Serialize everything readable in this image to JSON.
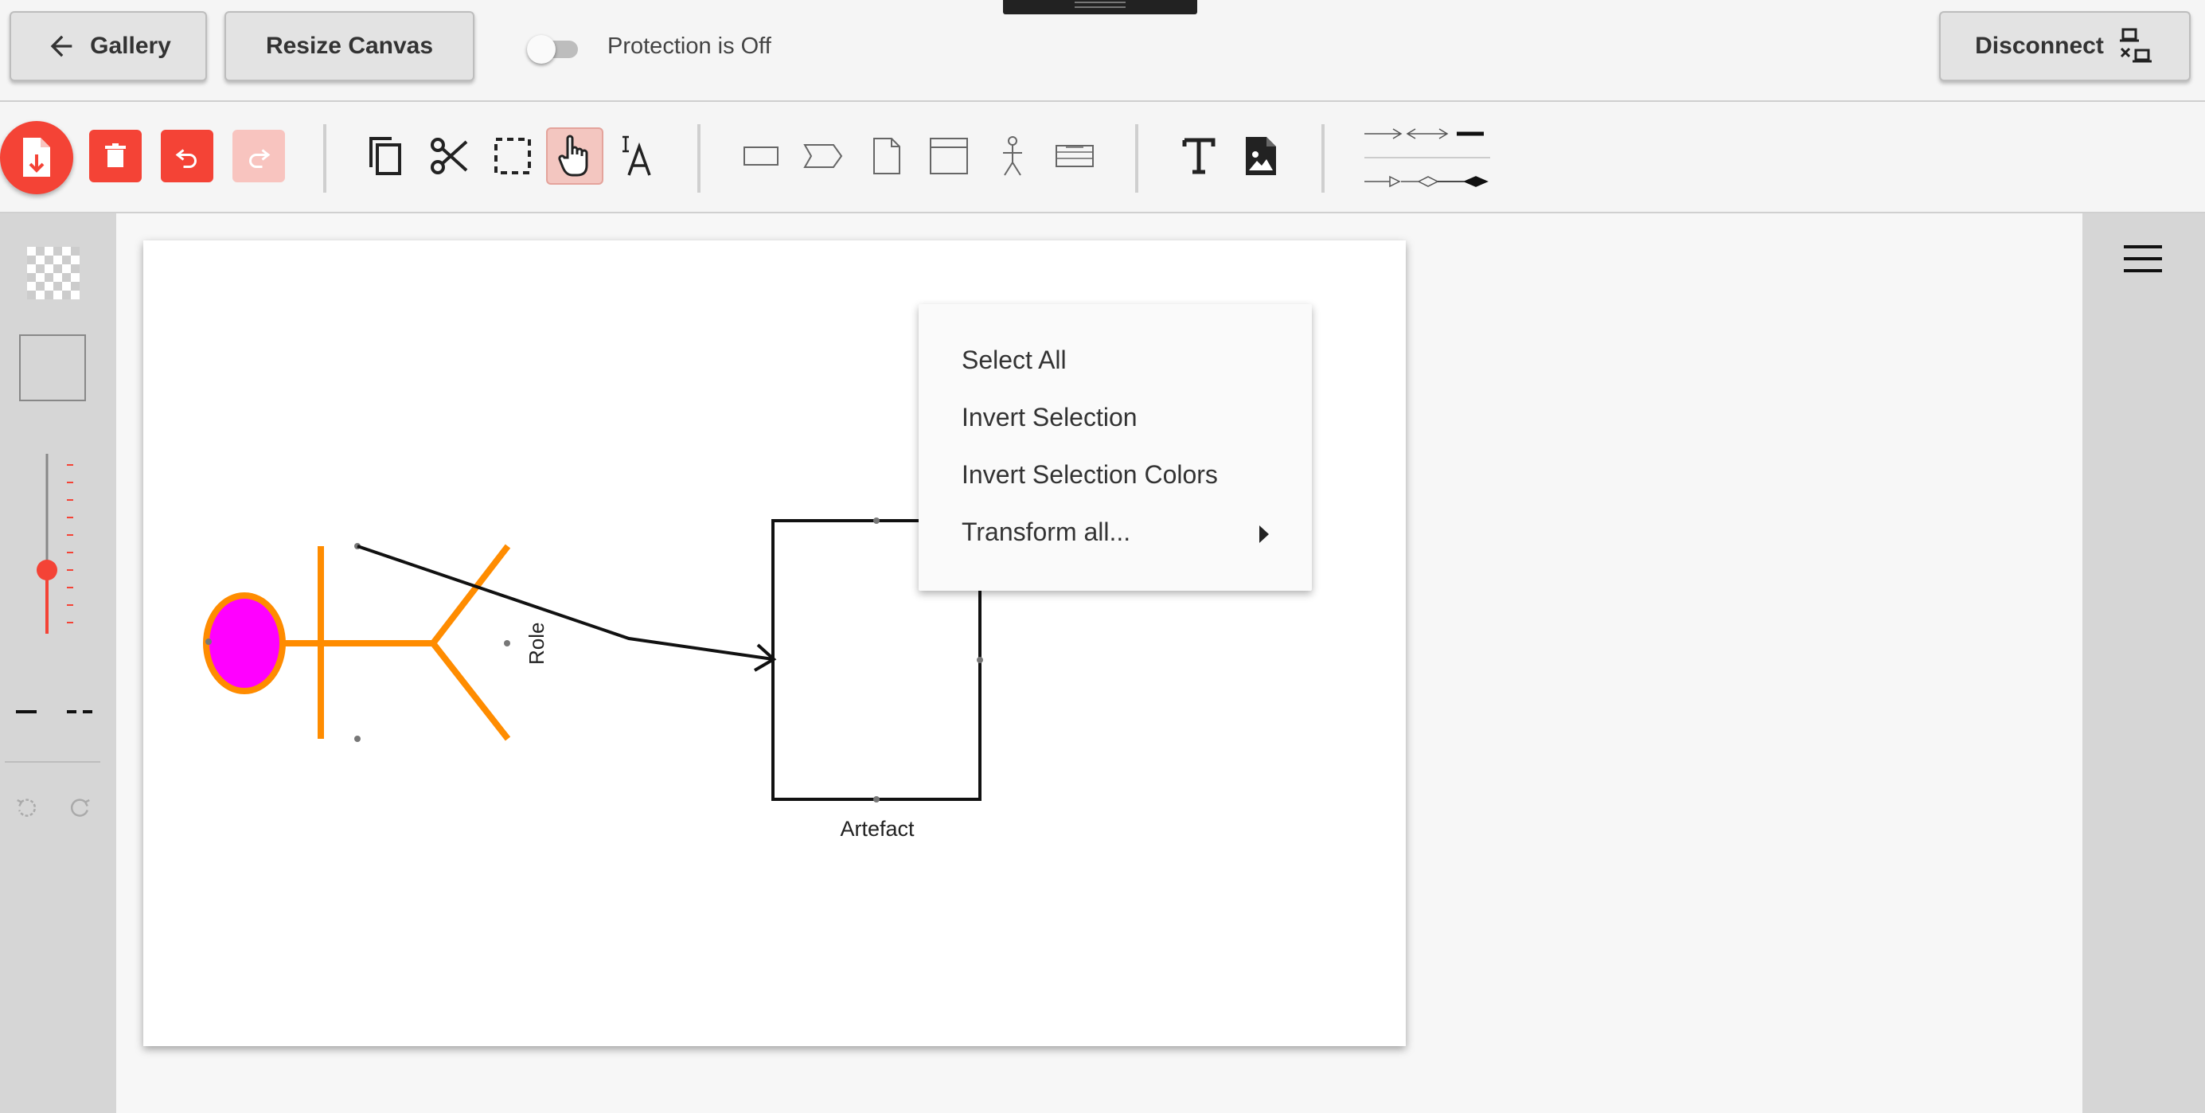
{
  "topbar": {
    "gallery_label": "Gallery",
    "resize_label": "Resize Canvas",
    "protection_label": "Protection is Off",
    "protection_on": false,
    "disconnect_label": "Disconnect"
  },
  "toolbar": {
    "file_tools": [
      "new-file-icon",
      "delete-icon",
      "undo-icon",
      "redo-icon"
    ],
    "edit_tools": [
      "copy-icon",
      "cut-icon",
      "select-rect-icon",
      "hand-pointer-icon",
      "text-cursor-icon"
    ],
    "shape_tools": [
      "rectangle-icon",
      "pentagon-arrow-icon",
      "document-icon",
      "window-icon",
      "stick-figure-icon",
      "table-icon"
    ],
    "insert_tools": [
      "text-icon",
      "image-file-icon"
    ],
    "active_tool": "hand-pointer-icon"
  },
  "colors": {
    "accent_red": "#f44336",
    "actor_fill": "#ff00ff",
    "actor_stroke": "#ff8c00"
  },
  "diagram": {
    "role_label": "Role",
    "artefact_label": "Artefact"
  },
  "context_menu": {
    "items": [
      "Select All",
      "Invert Selection",
      "Invert Selection Colors",
      "Transform all..."
    ]
  }
}
